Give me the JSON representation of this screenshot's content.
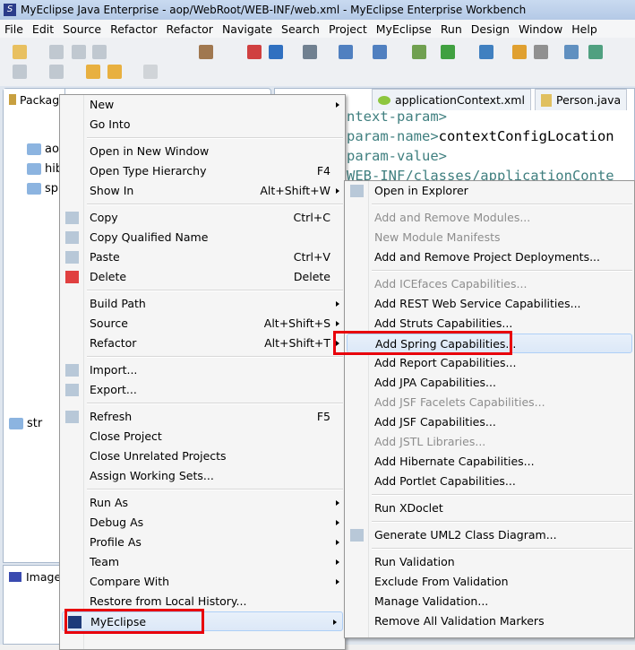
{
  "window": {
    "title": "MyEclipse Java Enterprise - aop/WebRoot/WEB-INF/web.xml - MyEclipse Enterprise Workbench"
  },
  "menubar": [
    "File",
    "Edit",
    "Source",
    "Refactor",
    "Refactor",
    "Navigate",
    "Search",
    "Project",
    "MyEclipse",
    "Run",
    "Design",
    "Window",
    "Help"
  ],
  "views": {
    "package_tab": "Packag",
    "image_tab": "Image"
  },
  "editor_tabs": [
    "applicationContext.xml",
    "Person.java"
  ],
  "code_lines": [
    "ntext-param>",
    "param-name>contextConfigLocation",
    "param-value>",
    "WEB-INF/classes/applicationConte"
  ],
  "tree": [
    "ao",
    "hib",
    "sp",
    "str"
  ],
  "context_menu": [
    {
      "label": "New",
      "sub": true
    },
    {
      "label": "Go Into"
    },
    {
      "sep": true
    },
    {
      "label": "Open in New Window"
    },
    {
      "label": "Open Type Hierarchy",
      "shortcut": "F4"
    },
    {
      "label": "Show In",
      "shortcut": "Alt+Shift+W",
      "sub": true
    },
    {
      "sep": true
    },
    {
      "label": "Copy",
      "shortcut": "Ctrl+C",
      "icon": "copy-icon"
    },
    {
      "label": "Copy Qualified Name",
      "icon": "copy-qualified-icon"
    },
    {
      "label": "Paste",
      "shortcut": "Ctrl+V",
      "icon": "paste-icon"
    },
    {
      "label": "Delete",
      "shortcut": "Delete",
      "icon": "delete-icon"
    },
    {
      "sep": true
    },
    {
      "label": "Build Path",
      "sub": true
    },
    {
      "label": "Source",
      "shortcut": "Alt+Shift+S",
      "sub": true
    },
    {
      "label": "Refactor",
      "shortcut": "Alt+Shift+T",
      "sub": true
    },
    {
      "sep": true
    },
    {
      "label": "Import...",
      "icon": "import-icon"
    },
    {
      "label": "Export...",
      "icon": "export-icon"
    },
    {
      "sep": true
    },
    {
      "label": "Refresh",
      "shortcut": "F5",
      "icon": "refresh-icon"
    },
    {
      "label": "Close Project"
    },
    {
      "label": "Close Unrelated Projects"
    },
    {
      "label": "Assign Working Sets..."
    },
    {
      "sep": true
    },
    {
      "label": "Run As",
      "sub": true
    },
    {
      "label": "Debug As",
      "sub": true
    },
    {
      "label": "Profile As",
      "sub": true
    },
    {
      "label": "Team",
      "sub": true
    },
    {
      "label": "Compare With",
      "sub": true
    },
    {
      "label": "Restore from Local History..."
    },
    {
      "label": "MyEclipse",
      "sub": true,
      "highlight": true,
      "icon": "myeclipse-icon"
    }
  ],
  "submenu": [
    {
      "label": "Open in Explorer",
      "icon": "folder-explorer-icon"
    },
    {
      "sep": true
    },
    {
      "label": "Add and Remove Modules...",
      "disabled": true
    },
    {
      "label": "New Module Manifests",
      "disabled": true
    },
    {
      "label": "Add and Remove Project Deployments..."
    },
    {
      "sep": true
    },
    {
      "label": "Add ICEfaces Capabilities...",
      "disabled": true
    },
    {
      "label": "Add REST Web Service Capabilities..."
    },
    {
      "label": "Add Struts Capabilities..."
    },
    {
      "label": "Add Spring Capabilities...",
      "highlight": true
    },
    {
      "label": "Add Report Capabilities..."
    },
    {
      "label": "Add JPA Capabilities..."
    },
    {
      "label": "Add JSF Facelets Capabilities...",
      "disabled": true
    },
    {
      "label": "Add JSF Capabilities..."
    },
    {
      "label": "Add JSTL Libraries...",
      "disabled": true
    },
    {
      "label": "Add Hibernate Capabilities..."
    },
    {
      "label": "Add Portlet Capabilities..."
    },
    {
      "sep": true
    },
    {
      "label": "Run XDoclet"
    },
    {
      "sep": true
    },
    {
      "label": "Generate UML2 Class Diagram...",
      "icon": "uml-diagram-icon"
    },
    {
      "sep": true
    },
    {
      "label": "Run Validation"
    },
    {
      "label": "Exclude From Validation"
    },
    {
      "label": "Manage Validation..."
    },
    {
      "label": "Remove All Validation Markers"
    }
  ],
  "colors": {
    "highlight_box": "#e8000b",
    "code_tag": "#3f7f7f"
  }
}
